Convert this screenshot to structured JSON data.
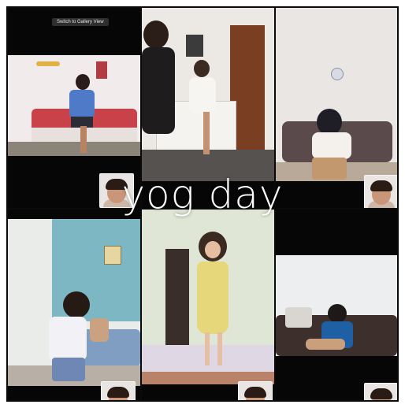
{
  "meeting": {
    "switch_view_label": "Switch to Gallery View",
    "overlay_caption": "yog day"
  },
  "participants": [
    {
      "tile": "top-left",
      "has_thumbnail": true
    },
    {
      "tile": "top-center",
      "has_thumbnail": false
    },
    {
      "tile": "top-right",
      "has_thumbnail": true
    },
    {
      "tile": "bottom-left",
      "has_thumbnail": true
    },
    {
      "tile": "bottom-center",
      "has_thumbnail": true
    },
    {
      "tile": "bottom-right",
      "has_thumbnail": true
    }
  ],
  "colors": {
    "background": "#0a0a0a",
    "caption": "#ffffff",
    "teal_wall": "#7db7c4",
    "yellow_dress": "#e6d77a"
  }
}
